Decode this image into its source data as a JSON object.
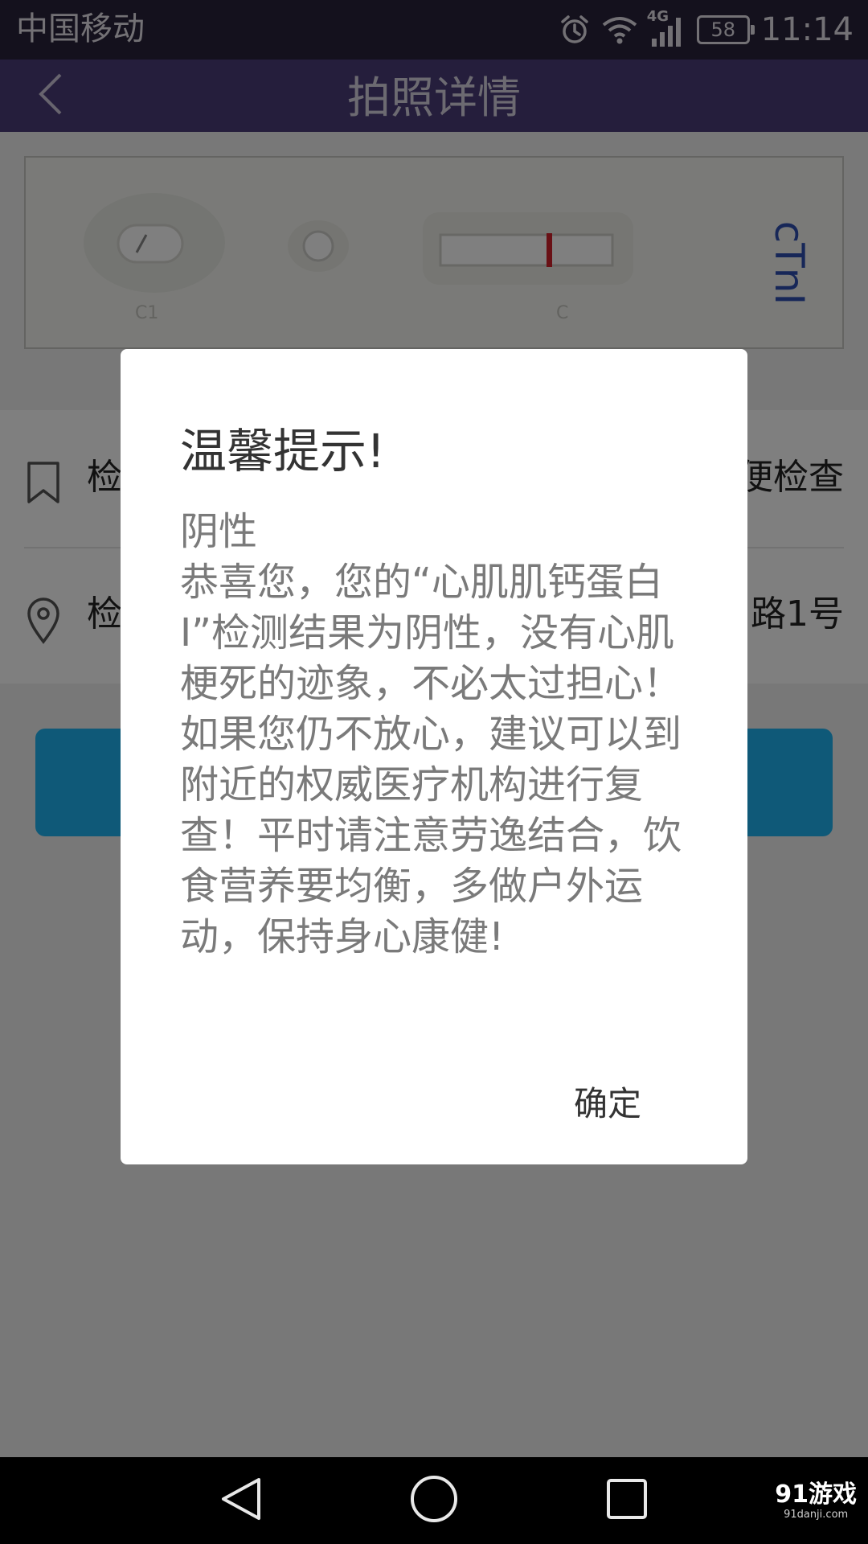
{
  "status_bar": {
    "carrier": "中国移动",
    "network": "4G",
    "battery": "58",
    "time": "11:14"
  },
  "app_bar": {
    "title": "拍照详情",
    "back_icon": "chevron-left-icon"
  },
  "photo": {
    "label": "cTnI"
  },
  "info_rows": [
    {
      "icon": "bookmark-icon",
      "label": "检",
      "value": "便检查"
    },
    {
      "icon": "location-pin-icon",
      "label": "检",
      "value": "路1号"
    }
  ],
  "dialog": {
    "title": "温馨提示!",
    "message": "阴性\n恭喜您，您的“心肌肌钙蛋白I”检测结果为阴性，没有心肌梗死的迹象，不必太过担心！如果您仍不放心，建议可以到附近的权威医疗机构进行复查！平时请注意劳逸结合，饮食营养要均衡，多做户外运动，保持身心康健!",
    "confirm_label": "确定"
  },
  "nav_bar": {
    "icons": [
      "back-triangle-icon",
      "home-circle-icon",
      "recents-square-icon"
    ]
  },
  "watermark": {
    "main": "91游戏",
    "sub": "91danji.com"
  },
  "colors": {
    "status_bar": "#28223a",
    "app_bar": "#4a3c78",
    "action_button": "#1eb3f0",
    "test_line": "#d3202a"
  }
}
